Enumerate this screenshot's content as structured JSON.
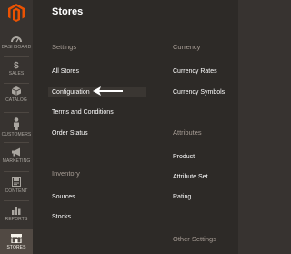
{
  "panel": {
    "title": "Stores"
  },
  "sidebar": {
    "items": [
      {
        "label": "DASHBOARD",
        "icon": "dashboard-icon"
      },
      {
        "label": "SALES",
        "icon": "dollar-icon"
      },
      {
        "label": "CATALOG",
        "icon": "box-icon"
      },
      {
        "label": "CUSTOMERS",
        "icon": "person-icon"
      },
      {
        "label": "MARKETING",
        "icon": "megaphone-icon"
      },
      {
        "label": "CONTENT",
        "icon": "content-icon"
      },
      {
        "label": "REPORTS",
        "icon": "bar-chart-icon"
      },
      {
        "label": "STORES",
        "icon": "storefront-icon",
        "active": true
      }
    ]
  },
  "sections": {
    "settings": {
      "title": "Settings",
      "links": [
        "All Stores",
        "Configuration",
        "Terms and Conditions",
        "Order Status"
      ]
    },
    "inventory": {
      "title": "Inventory",
      "links": [
        "Sources",
        "Stocks"
      ]
    },
    "currency": {
      "title": "Currency",
      "links": [
        "Currency Rates",
        "Currency Symbols"
      ]
    },
    "attributes": {
      "title": "Attributes",
      "links": [
        "Product",
        "Attribute Set",
        "Rating"
      ]
    },
    "other": {
      "title": "Other Settings"
    }
  },
  "colors": {
    "accent": "#eb5202",
    "panel_bg": "#2d2a27",
    "sidebar_bg": "#373330",
    "active_bg": "#514943"
  }
}
